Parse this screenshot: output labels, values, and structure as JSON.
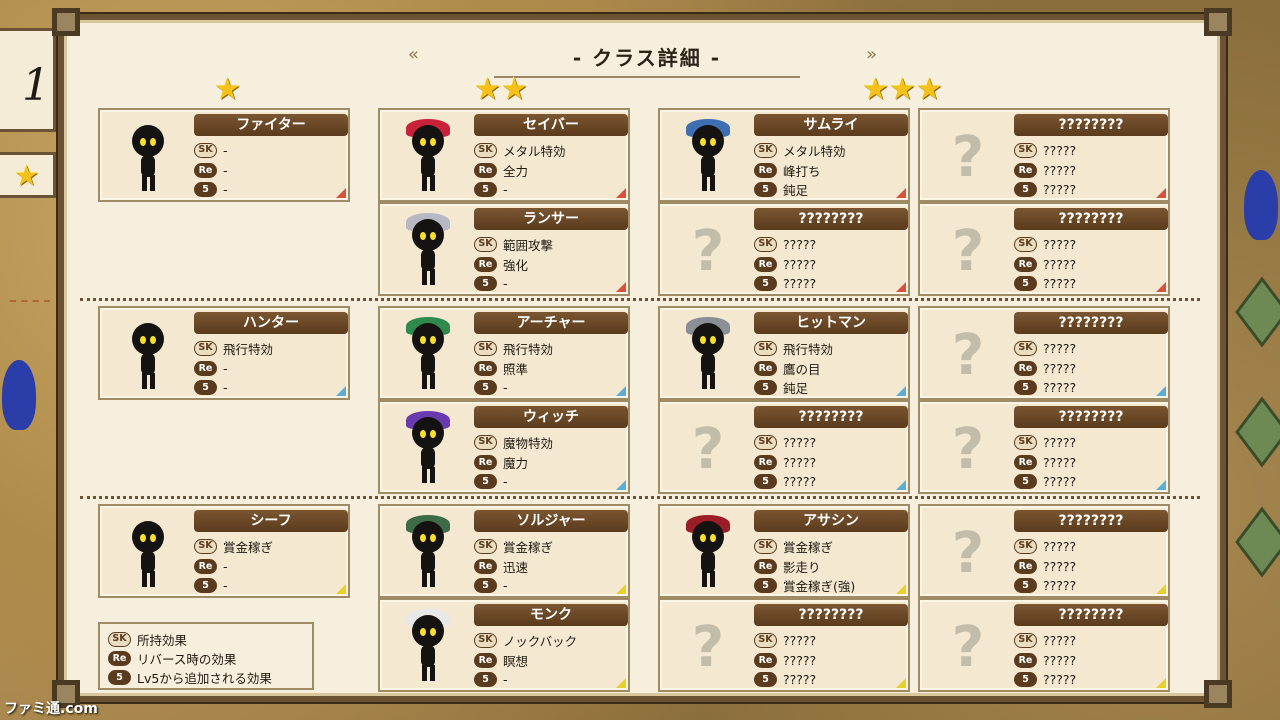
{
  "panel": {
    "title": "- クラス詳細 -",
    "left_chevron": "«",
    "right_chevron": "»"
  },
  "side": {
    "number_fragment": "1",
    "star": "★"
  },
  "tiers": [
    {
      "stars": "★"
    },
    {
      "stars": "★★"
    },
    {
      "stars": "★★★"
    }
  ],
  "badges": {
    "sk": "SK",
    "re": "Re",
    "lv5": "5"
  },
  "cards": [
    {
      "id": "fighter",
      "name": "ファイター",
      "sk": "-",
      "re": "-",
      "lv5": "-",
      "tri": "red"
    },
    {
      "id": "saber",
      "name": "セイバー",
      "sk": "メタル特効",
      "re": "全力",
      "lv5": "-",
      "tri": "red"
    },
    {
      "id": "samurai",
      "name": "サムライ",
      "sk": "メタル特効",
      "re": "峰打ち",
      "lv5": "鈍足",
      "tri": "red"
    },
    {
      "id": "unknown-1",
      "name": "????????",
      "sk": "?????",
      "re": "?????",
      "lv5": "?????",
      "tri": "red"
    },
    {
      "id": "lancer",
      "name": "ランサー",
      "sk": "範囲攻撃",
      "re": "強化",
      "lv5": "-",
      "tri": "red"
    },
    {
      "id": "unknown-2",
      "name": "????????",
      "sk": "?????",
      "re": "?????",
      "lv5": "?????",
      "tri": "red"
    },
    {
      "id": "unknown-3",
      "name": "????????",
      "sk": "?????",
      "re": "?????",
      "lv5": "?????",
      "tri": "red"
    },
    {
      "id": "hunter",
      "name": "ハンター",
      "sk": "飛行特効",
      "re": "-",
      "lv5": "-",
      "tri": "blue"
    },
    {
      "id": "archer",
      "name": "アーチャー",
      "sk": "飛行特効",
      "re": "照準",
      "lv5": "-",
      "tri": "blue"
    },
    {
      "id": "hitman",
      "name": "ヒットマン",
      "sk": "飛行特効",
      "re": "鷹の目",
      "lv5": "鈍足",
      "tri": "blue"
    },
    {
      "id": "unknown-4",
      "name": "????????",
      "sk": "?????",
      "re": "?????",
      "lv5": "?????",
      "tri": "blue"
    },
    {
      "id": "witch",
      "name": "ウィッチ",
      "sk": "魔物特効",
      "re": "魔力",
      "lv5": "-",
      "tri": "blue"
    },
    {
      "id": "unknown-5",
      "name": "????????",
      "sk": "?????",
      "re": "?????",
      "lv5": "?????",
      "tri": "blue"
    },
    {
      "id": "unknown-6",
      "name": "????????",
      "sk": "?????",
      "re": "?????",
      "lv5": "?????",
      "tri": "blue"
    },
    {
      "id": "thief",
      "name": "シーフ",
      "sk": "賞金稼ぎ",
      "re": "-",
      "lv5": "-",
      "tri": "yellow"
    },
    {
      "id": "soldier",
      "name": "ソルジャー",
      "sk": "賞金稼ぎ",
      "re": "迅速",
      "lv5": "-",
      "tri": "yellow"
    },
    {
      "id": "assassin",
      "name": "アサシン",
      "sk": "賞金稼ぎ",
      "re": "影走り",
      "lv5": "賞金稼ぎ(強)",
      "tri": "yellow"
    },
    {
      "id": "unknown-7",
      "name": "????????",
      "sk": "?????",
      "re": "?????",
      "lv5": "?????",
      "tri": "yellow"
    },
    {
      "id": "monk",
      "name": "モンク",
      "sk": "ノックバック",
      "re": "瞑想",
      "lv5": "-",
      "tri": "yellow"
    },
    {
      "id": "unknown-8",
      "name": "????????",
      "sk": "?????",
      "re": "?????",
      "lv5": "?????",
      "tri": "yellow"
    },
    {
      "id": "unknown-9",
      "name": "????????",
      "sk": "?????",
      "re": "?????",
      "lv5": "?????",
      "tri": "yellow"
    }
  ],
  "legend": {
    "sk_text": "所持効果",
    "re_text": "リバース時の効果",
    "lv5_text": "Lv5から追加される効果"
  },
  "watermark": "ファミ通.com",
  "colors": {
    "header_brown": "#5a3b1d",
    "star_gold": "#f6c21a",
    "tier1_red": "#d8513c",
    "tier2_blue": "#5aaed5",
    "tier3_yellow": "#e9cf2c",
    "eye_yellow": "#f7e02b"
  }
}
